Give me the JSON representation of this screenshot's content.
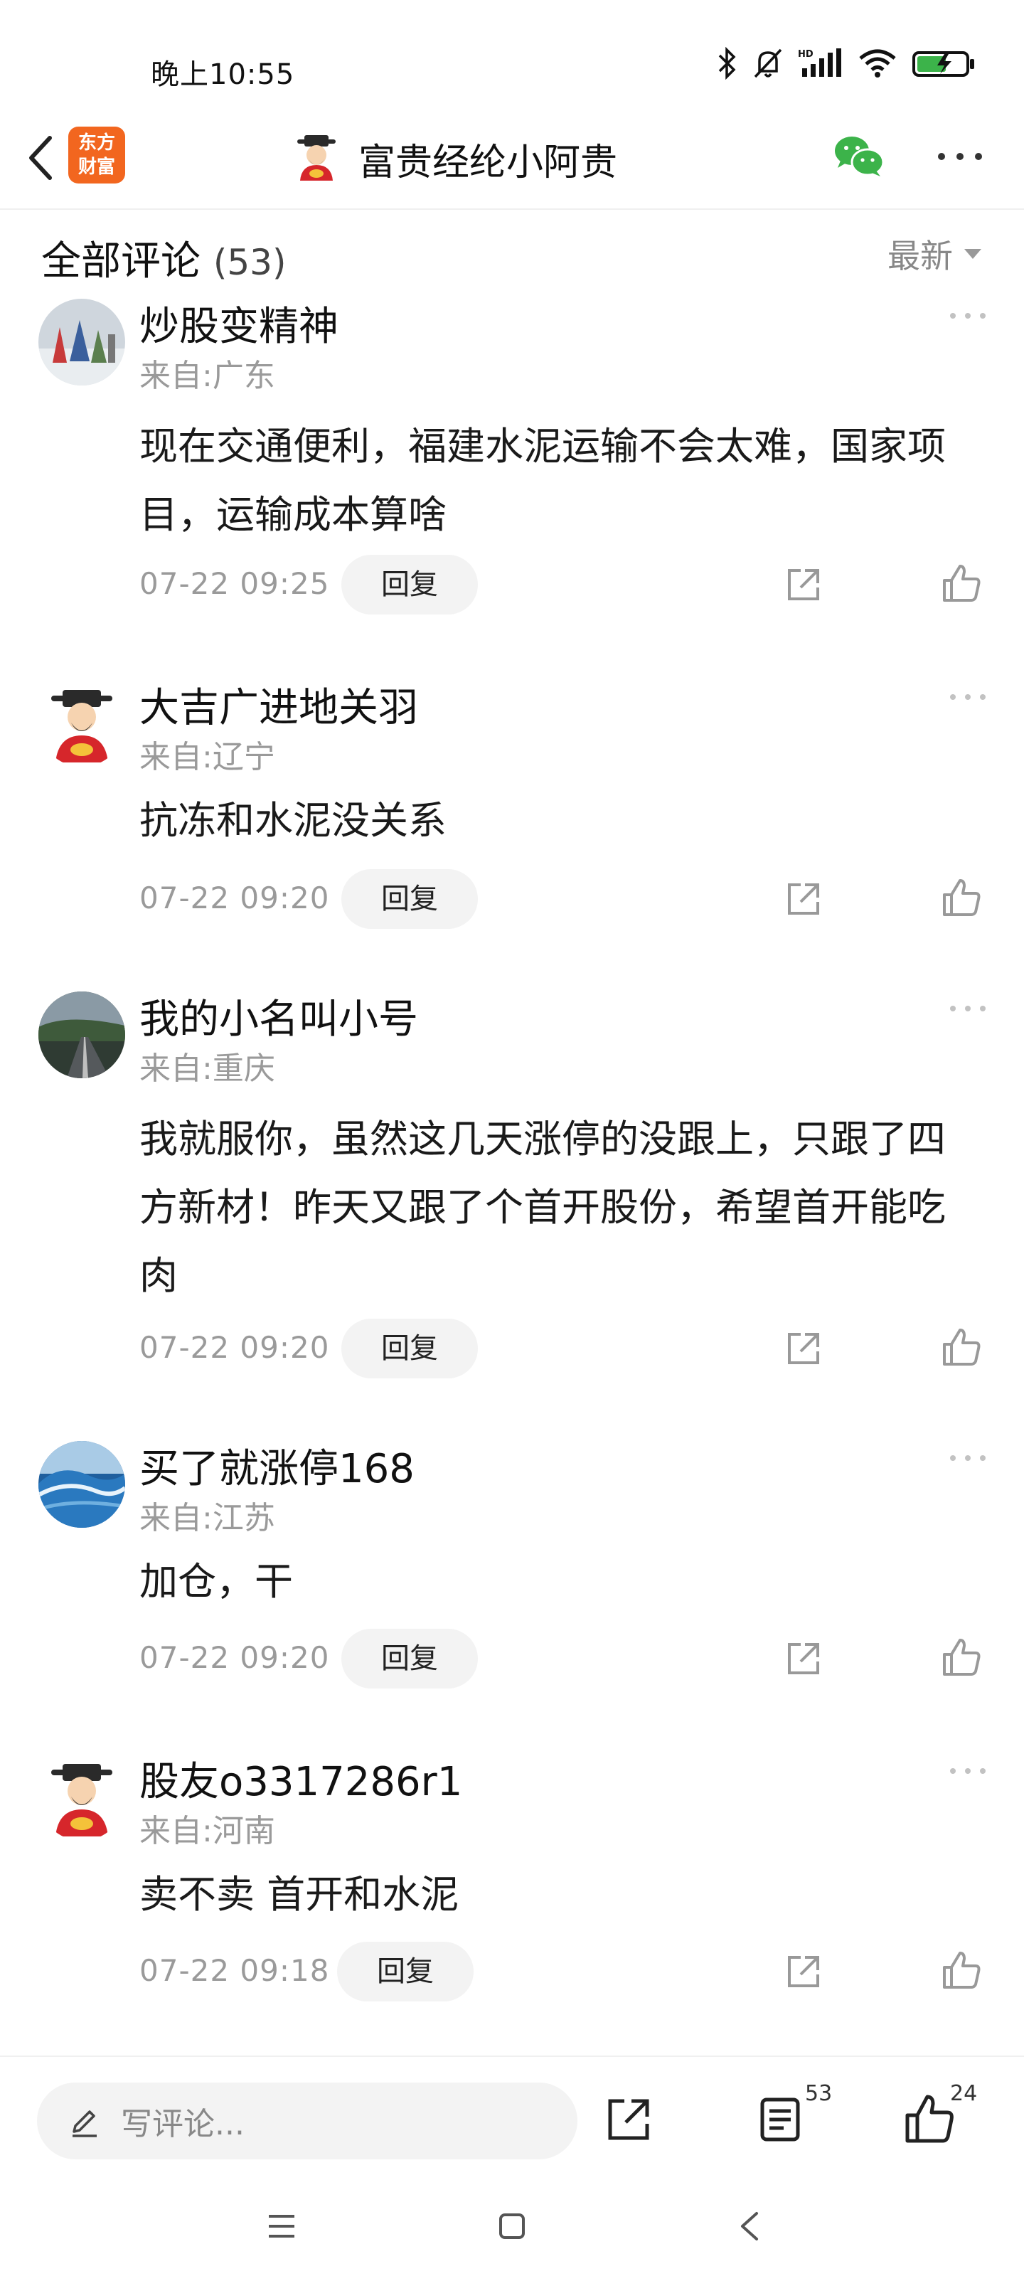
{
  "status_bar": {
    "time": "晚上10:55",
    "icons": [
      "bluetooth-icon",
      "mute-icon",
      "signal-hd-icon",
      "wifi-icon",
      "battery-charging-icon"
    ]
  },
  "header": {
    "brand_logo_line1": "东方",
    "brand_logo_line2": "财富",
    "title": "富贵经纶小阿贵",
    "colors": {
      "brand": "#f2661f",
      "wechat": "#3cb34a"
    }
  },
  "comments_header": {
    "title": "全部评论",
    "count": "(53)",
    "sort_label": "最新"
  },
  "comments": [
    {
      "name": "炒股变精神",
      "location": "来自:广东",
      "text": "现在交通便利，福建水泥运输不会太难，国家项目，运输成本算啥",
      "date": "07-22 09:25",
      "reply_label": "回复"
    },
    {
      "name": "大吉广进地关羽",
      "location": "来自:辽宁",
      "text": "抗冻和水泥没关系",
      "date": "07-22 09:20",
      "reply_label": "回复"
    },
    {
      "name": "我的小名叫小号",
      "location": "来自:重庆",
      "text": "我就服你，虽然这几天涨停的没跟上，只跟了四方新材！昨天又跟了个首开股份，希望首开能吃肉",
      "date": "07-22 09:20",
      "reply_label": "回复"
    },
    {
      "name": "买了就涨停168",
      "location": "来自:江苏",
      "text": "加仓，干",
      "date": "07-22 09:20",
      "reply_label": "回复"
    },
    {
      "name": "股友o3317286r1",
      "location": "来自:河南",
      "text": "卖不卖 首开和水泥",
      "date": "07-22 09:18",
      "reply_label": "回复"
    }
  ],
  "bottom_bar": {
    "write_placeholder": "写评论...",
    "comments_count": "53",
    "likes_count": "24"
  }
}
